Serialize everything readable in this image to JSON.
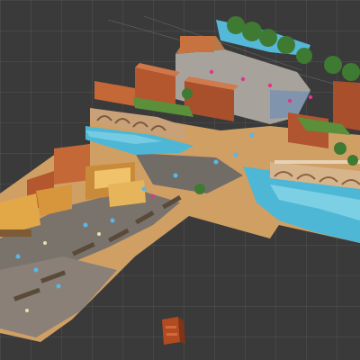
{
  "view": {
    "type": "game-engine-scene-view",
    "background": "#3a3a3a",
    "grid": true,
    "colors": {
      "water": "#4fb7d6",
      "water_light": "#8fdaea",
      "sand": "#d6a66a",
      "road": "#6e6a66",
      "brick": "#b4562e",
      "wood": "#d7963c",
      "grass": "#5c8f39",
      "tree": "#3f7a32",
      "accent_pink": "#e0358a",
      "accent_blue": "#58b8e8"
    }
  },
  "scene": {
    "objects": [
      "harbor-town-diorama",
      "canal",
      "stone-bridge",
      "arched-bridge",
      "market-street",
      "shop-row",
      "plaza",
      "trees",
      "stray-crate-prop"
    ]
  }
}
